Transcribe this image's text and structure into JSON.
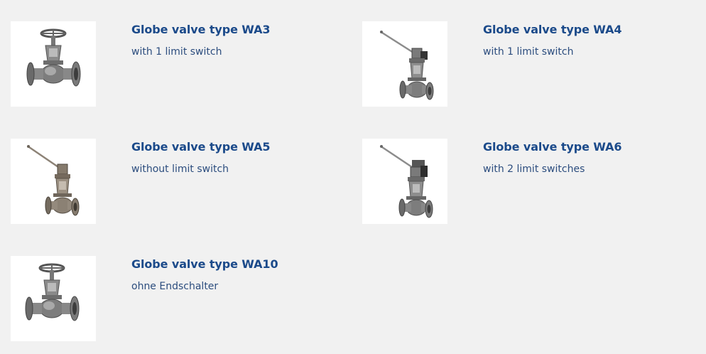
{
  "products": [
    {
      "title": "Globe valve type WA3",
      "subtitle": "with 1 limit switch",
      "image_icon": "handwheel-globe-valve-icon"
    },
    {
      "title": "Globe valve type WA4",
      "subtitle": "with 1 limit switch",
      "image_icon": "lever-globe-valve-icon"
    },
    {
      "title": "Globe valve type WA5",
      "subtitle": "without limit switch",
      "image_icon": "lever-globe-valve-icon"
    },
    {
      "title": "Globe valve type WA6",
      "subtitle": "with 2 limit switches",
      "image_icon": "lever-globe-valve-icon"
    },
    {
      "title": "Globe valve type WA10",
      "subtitle": "ohne Endschalter",
      "image_icon": "handwheel-globe-valve-icon"
    }
  ],
  "colors": {
    "background": "#f1f1f1",
    "title": "#1b4a8a",
    "subtitle": "#2c4d7e",
    "thumbnail_bg": "#ffffff"
  }
}
